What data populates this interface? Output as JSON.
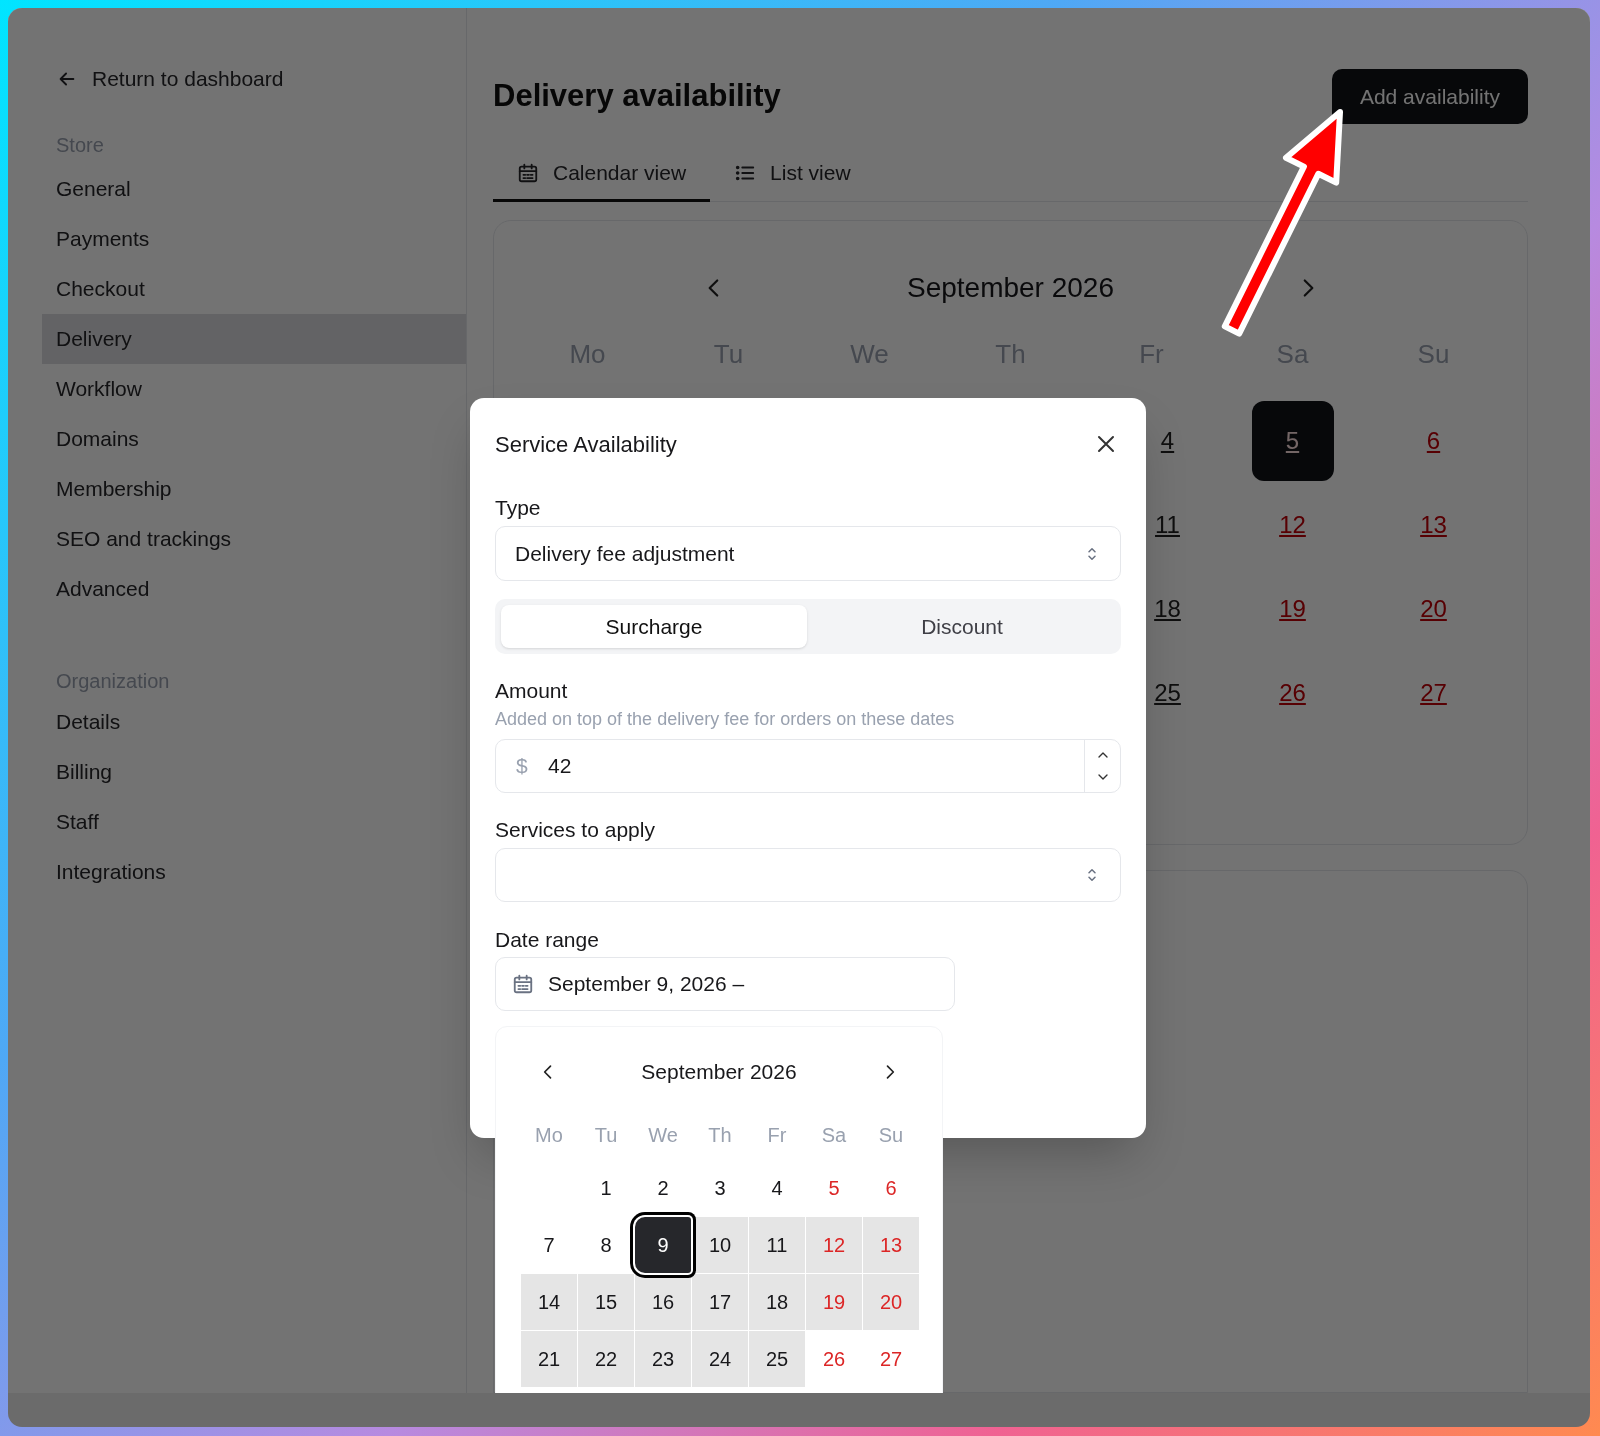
{
  "sidebar": {
    "back_link": "Return to dashboard",
    "sections": [
      {
        "heading": "Store",
        "items": [
          {
            "label": "General",
            "selected": false
          },
          {
            "label": "Payments",
            "selected": false
          },
          {
            "label": "Checkout",
            "selected": false
          },
          {
            "label": "Delivery",
            "selected": true
          },
          {
            "label": "Workflow",
            "selected": false
          },
          {
            "label": "Domains",
            "selected": false
          },
          {
            "label": "Membership",
            "selected": false
          },
          {
            "label": "SEO and trackings",
            "selected": false
          },
          {
            "label": "Advanced",
            "selected": false
          }
        ]
      },
      {
        "heading": "Organization",
        "items": [
          {
            "label": "Details",
            "selected": false
          },
          {
            "label": "Billing",
            "selected": false
          },
          {
            "label": "Staff",
            "selected": false
          },
          {
            "label": "Integrations",
            "selected": false
          }
        ]
      }
    ]
  },
  "header": {
    "title": "Delivery availability",
    "primary_button": "Add availability"
  },
  "tabs": [
    {
      "label": "Calendar view",
      "kind": "calendar",
      "selected": true
    },
    {
      "label": "List view",
      "kind": "list",
      "selected": false
    }
  ],
  "calendar": {
    "month": "September 2026",
    "weekdays": [
      "Mo",
      "Tu",
      "We",
      "Th",
      "Fr",
      "Sa",
      "Su"
    ],
    "weeks": [
      [
        {
          "day": "4",
          "weekend": false,
          "selected": false
        },
        {
          "day": "5",
          "weekend": true,
          "selected": true
        },
        {
          "day": "6",
          "weekend": true,
          "selected": false
        }
      ],
      [
        {
          "day": "11",
          "weekend": false,
          "selected": false
        },
        {
          "day": "12",
          "weekend": true,
          "selected": false
        },
        {
          "day": "13",
          "weekend": true,
          "selected": false
        }
      ],
      [
        {
          "day": "18",
          "weekend": false,
          "selected": false
        },
        {
          "day": "19",
          "weekend": true,
          "selected": false
        },
        {
          "day": "20",
          "weekend": true,
          "selected": false
        }
      ],
      [
        {
          "day": "25",
          "weekend": false,
          "selected": false
        },
        {
          "day": "26",
          "weekend": true,
          "selected": false
        },
        {
          "day": "27",
          "weekend": true,
          "selected": false
        }
      ]
    ]
  },
  "dialog": {
    "title": "Service Availability",
    "type_field": {
      "label": "Type",
      "value": "Delivery fee adjustment"
    },
    "adjustment_options": [
      {
        "label": "Surcharge",
        "selected": true
      },
      {
        "label": "Discount",
        "selected": false
      }
    ],
    "amount_field": {
      "label": "Amount",
      "hint": "Added on top of the delivery fee for orders on these dates",
      "currency": "$",
      "value": "42"
    },
    "services_field": {
      "label": "Services to apply"
    },
    "date_range_field": {
      "label": "Date range",
      "value": "September 9, 2026 –"
    },
    "date_picker": {
      "month": "September 2026",
      "weekdays": [
        "Mo",
        "Tu",
        "We",
        "Th",
        "Fr",
        "Sa",
        "Su"
      ],
      "weeks": [
        [
          {
            "day": "1",
            "weekend": false,
            "selected": false,
            "in_range": false
          },
          {
            "day": "2",
            "weekend": false,
            "selected": false,
            "in_range": false
          },
          {
            "day": "3",
            "weekend": false,
            "selected": false,
            "in_range": false
          },
          {
            "day": "4",
            "weekend": false,
            "selected": false,
            "in_range": false
          },
          {
            "day": "5",
            "weekend": true,
            "selected": false,
            "in_range": false
          },
          {
            "day": "6",
            "weekend": true,
            "selected": false,
            "in_range": false
          }
        ],
        [
          {
            "day": "7",
            "weekend": false,
            "selected": false,
            "in_range": false
          },
          {
            "day": "8",
            "weekend": false,
            "selected": false,
            "in_range": false
          },
          {
            "day": "9",
            "weekend": false,
            "selected": true,
            "in_range": false
          },
          {
            "day": "10",
            "weekend": false,
            "selected": false,
            "in_range": true
          },
          {
            "day": "11",
            "weekend": false,
            "selected": false,
            "in_range": true
          },
          {
            "day": "12",
            "weekend": true,
            "selected": false,
            "in_range": true
          },
          {
            "day": "13",
            "weekend": true,
            "selected": false,
            "in_range": true
          }
        ],
        [
          {
            "day": "14",
            "weekend": false,
            "selected": false,
            "in_range": true
          },
          {
            "day": "15",
            "weekend": false,
            "selected": false,
            "in_range": true
          },
          {
            "day": "16",
            "weekend": false,
            "selected": false,
            "in_range": true
          },
          {
            "day": "17",
            "weekend": false,
            "selected": false,
            "in_range": true
          },
          {
            "day": "18",
            "weekend": false,
            "selected": false,
            "in_range": true
          },
          {
            "day": "19",
            "weekend": true,
            "selected": false,
            "in_range": true
          },
          {
            "day": "20",
            "weekend": true,
            "selected": false,
            "in_range": true
          }
        ],
        [
          {
            "day": "21",
            "weekend": false,
            "selected": false,
            "in_range": true
          },
          {
            "day": "22",
            "weekend": false,
            "selected": false,
            "in_range": true
          },
          {
            "day": "23",
            "weekend": false,
            "selected": false,
            "in_range": true
          },
          {
            "day": "24",
            "weekend": false,
            "selected": false,
            "in_range": true
          },
          {
            "day": "25",
            "weekend": false,
            "selected": false,
            "in_range": true
          },
          {
            "day": "26",
            "weekend": true,
            "selected": false,
            "in_range": false
          },
          {
            "day": "27",
            "weekend": true,
            "selected": false,
            "in_range": false
          }
        ]
      ]
    }
  }
}
